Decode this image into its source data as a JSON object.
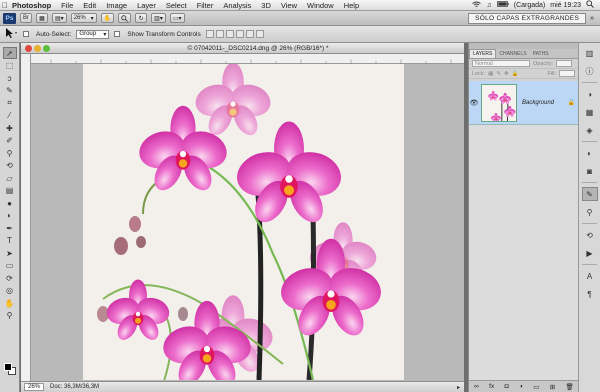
{
  "menubar": {
    "app": "Photoshop",
    "items": [
      "File",
      "Edit",
      "Image",
      "Layer",
      "Select",
      "Filter",
      "Analysis",
      "3D",
      "View",
      "Window",
      "Help"
    ],
    "battery": "(Cargada)",
    "clock": "mié 19:23"
  },
  "appbar": {
    "logo": "Ps",
    "zoom": "26%",
    "workspace": "SÓLO CAPAS EXTRAGRANDES"
  },
  "options": {
    "auto_select_label": "Auto-Select:",
    "auto_select_value": "Group",
    "transform_label": "Show Transform Controls"
  },
  "document": {
    "title": "© 07042011-_DSC0214.dng @ 26% (RGB/16*) *",
    "status_zoom": "26%",
    "status_doc": "Doc: 36,3M/36,3M"
  },
  "layers_panel": {
    "tabs": [
      "LAYERS",
      "CHANNELS",
      "PATHS"
    ],
    "blend_mode": "Normal",
    "opacity_label": "Opacity:",
    "fill_label": "Fill:",
    "lock_label": "Lock:",
    "layer_name": "Background"
  },
  "colors": {
    "orchid": "#e24fb7",
    "orchid_light": "#f29bd8",
    "layer_selected": "#bcd7f6"
  }
}
